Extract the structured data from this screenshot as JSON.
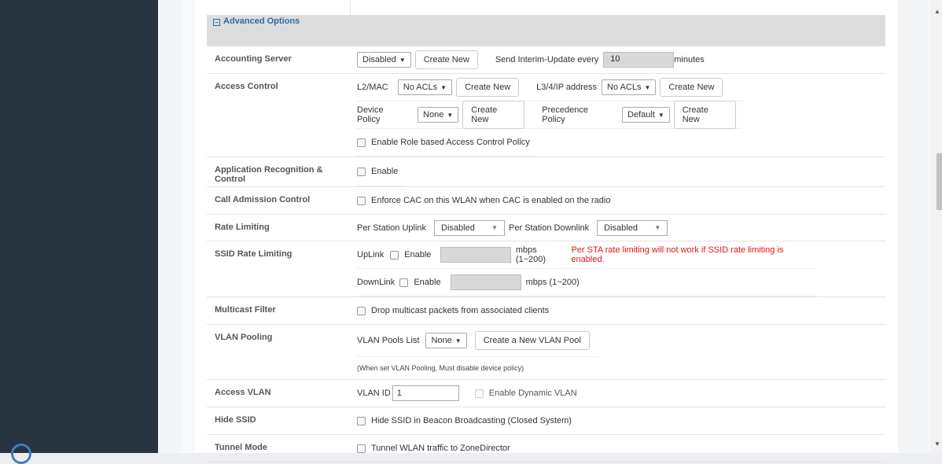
{
  "section_title": "Advanced Options",
  "rows": {
    "accounting": {
      "label": "Accounting Server",
      "select": "Disabled",
      "create": "Create New",
      "interim_label": "Send Interim-Update every",
      "interim_value": "10",
      "interim_unit": "minutes"
    },
    "access_control": {
      "label": "Access Control",
      "l2_label": "L2/MAC",
      "l2_select": "No ACLs",
      "l2_create": "Create New",
      "l3_label": "L3/4/IP address",
      "l3_select": "No ACLs",
      "l3_create": "Create New",
      "device_label": "Device Policy",
      "device_select": "None",
      "device_create": "Create New",
      "prec_label": "Precedence Policy",
      "prec_select": "Default",
      "prec_create": "Create New",
      "role_label": "Enable Role based Access Control Policy"
    },
    "app_recognition": {
      "label": "Application Recognition & Control",
      "enable": "Enable"
    },
    "cac": {
      "label": "Call Admission Control",
      "text": "Enforce CAC on this WLAN when CAC is enabled on the radio"
    },
    "rate_limiting": {
      "label": "Rate Limiting",
      "uplink_label": "Per Station Uplink",
      "uplink_value": "Disabled",
      "downlink_label": "Per Station Downlink",
      "downlink_value": "Disabled"
    },
    "ssid_rate": {
      "label": "SSID Rate Limiting",
      "uplink_label": "UpLink",
      "uplink_enable": "Enable",
      "uplink_unit": "mbps (1~200)",
      "warning": "Per STA rate limiting will not work if SSID rate limiting is enabled.",
      "downlink_label": "DownLink",
      "downlink_enable": "Enable",
      "downlink_unit": "mbps (1~200)"
    },
    "multicast": {
      "label": "Multicast Filter",
      "text": "Drop multicast packets from associated clients"
    },
    "vlan_pooling": {
      "label": "VLAN Pooling",
      "list_label": "VLAN Pools List",
      "list_select": "None",
      "create": "Create a New VLAN Pool",
      "note": "(When set VLAN Pooling, Must disable device policy)"
    },
    "access_vlan": {
      "label": "Access VLAN",
      "id_label": "VLAN ID",
      "id_value": "1",
      "dynamic": "Enable Dynamic VLAN"
    },
    "hide_ssid": {
      "label": "Hide SSID",
      "text": "Hide SSID in Beacon Broadcasting (Closed System)"
    },
    "tunnel": {
      "label": "Tunnel Mode",
      "text": "Tunnel WLAN traffic to ZoneDirector"
    }
  },
  "icons": {
    "collapse": "minus-box-icon",
    "dropdown": "caret-down-icon"
  }
}
